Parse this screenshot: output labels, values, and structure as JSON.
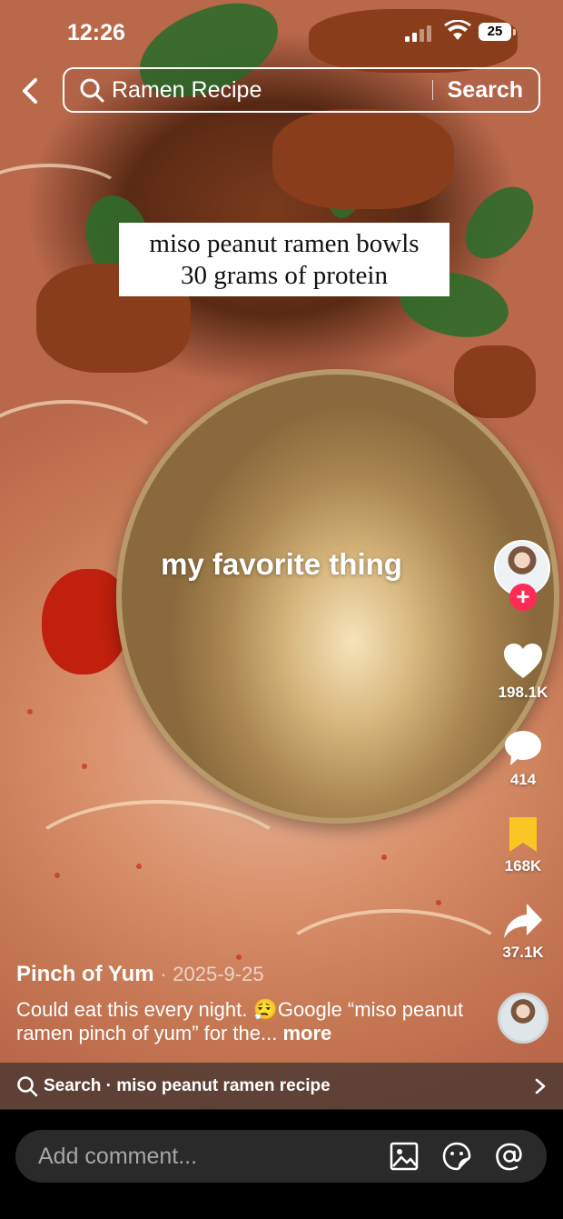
{
  "status_bar": {
    "time": "12:26",
    "battery": "25"
  },
  "search": {
    "query": "Ramen Recipe",
    "button": "Search"
  },
  "video": {
    "caption_lines": [
      "miso peanut ramen bowls",
      "30 grams of protein"
    ],
    "overlay_text": "my favorite thing"
  },
  "actions": {
    "likes": "198.1K",
    "comments": "414",
    "saves": "168K",
    "shares": "37.1K"
  },
  "post": {
    "author": "Pinch of Yum",
    "separator": "·",
    "date": "2025-9-25",
    "description": "Could eat this every night. 😮‍💨Google “miso peanut ramen pinch of yum” for the...",
    "more": "more"
  },
  "related_search": {
    "label": "Search · miso peanut ramen recipe"
  },
  "comment_bar": {
    "placeholder": "Add comment..."
  },
  "colors": {
    "follow": "#fe2c55",
    "save": "#f9c623",
    "comment_bg": "#2a2a2a"
  }
}
